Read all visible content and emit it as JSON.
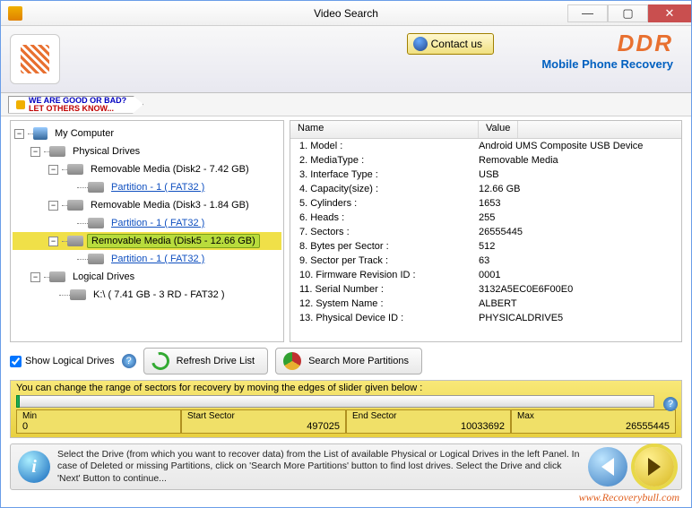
{
  "window_title": "Video Search",
  "contact_label": "Contact us",
  "brand_name": "DDR",
  "brand_subtitle": "Mobile Phone Recovery",
  "ribbon_line1": "WE ARE GOOD OR BAD?",
  "ribbon_line2": "LET OTHERS KNOW...",
  "tree": {
    "root": "My Computer",
    "physical": "Physical Drives",
    "disk2": "Removable Media (Disk2 - 7.42 GB)",
    "disk2_part": "Partition - 1 ( FAT32 )",
    "disk3": "Removable Media (Disk3 - 1.84 GB)",
    "disk3_part": "Partition - 1 ( FAT32 )",
    "disk5": "Removable Media (Disk5 - 12.66 GB)",
    "disk5_part": "Partition - 1 ( FAT32 )",
    "logical": "Logical Drives",
    "k_drive": "K:\\ ( 7.41 GB - 3 RD - FAT32 )"
  },
  "props_header": {
    "name": "Name",
    "value": "Value"
  },
  "props": [
    {
      "n": "1. Model :",
      "v": "Android UMS Composite USB Device"
    },
    {
      "n": "2. MediaType :",
      "v": "Removable Media"
    },
    {
      "n": "3. Interface Type :",
      "v": "USB"
    },
    {
      "n": "4. Capacity(size) :",
      "v": "12.66 GB"
    },
    {
      "n": "5. Cylinders :",
      "v": "1653"
    },
    {
      "n": "6. Heads :",
      "v": "255"
    },
    {
      "n": "7. Sectors :",
      "v": "26555445"
    },
    {
      "n": "8. Bytes per Sector :",
      "v": "512"
    },
    {
      "n": "9. Sector per Track :",
      "v": "63"
    },
    {
      "n": "10. Firmware Revision ID :",
      "v": "0001"
    },
    {
      "n": "11. Serial Number :",
      "v": "3132A5EC0E6F00E0"
    },
    {
      "n": "12. System Name :",
      "v": "ALBERT"
    },
    {
      "n": "13. Physical Device ID :",
      "v": "PHYSICALDRIVE5"
    }
  ],
  "show_logical_label": "Show Logical Drives",
  "refresh_label": "Refresh Drive List",
  "search_more_label": "Search More Partitions",
  "slider": {
    "title": "You can change the range of sectors for recovery by moving the edges of slider given below :",
    "min_label": "Min",
    "min_val": "0",
    "start_label": "Start Sector",
    "start_val": "497025",
    "end_label": "End Sector",
    "end_val": "10033692",
    "max_label": "Max",
    "max_val": "26555445"
  },
  "footer_text": "Select the Drive (from which you want to recover data) from the List of available Physical or Logical Drives in the left Panel. In case of Deleted or missing Partitions, click on 'Search More Partitions' button to find lost drives. Select the Drive and click 'Next' Button to continue...",
  "watermark": "www.Recoverybull.com"
}
